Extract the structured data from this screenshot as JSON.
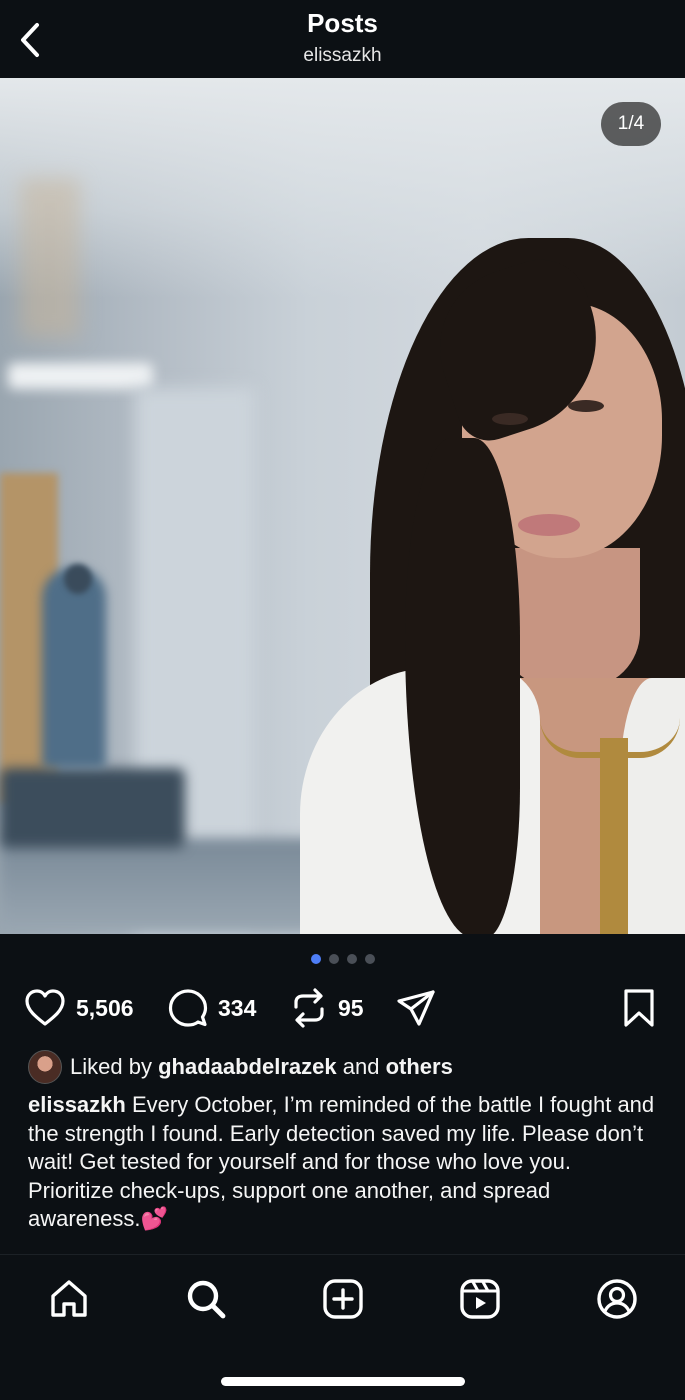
{
  "header": {
    "title": "Posts",
    "username": "elissazkh",
    "back_icon": "chevron-left-icon"
  },
  "post": {
    "media_counter": "1/4",
    "carousel": {
      "total": 4,
      "active_index": 0
    },
    "likes_count": "5,506",
    "comments_count": "334",
    "reposts_count": "95",
    "liked_by_prefix": "Liked by",
    "liked_by_user": "ghadaabdelrazek",
    "liked_by_and": "and",
    "liked_by_others": "others",
    "caption_user": "elissazkh",
    "caption_text": "Every October, I’m reminded of the battle I fought and the strength I found. Early detection saved my life. Please don’t wait! Get tested for yourself and for those who love you. Prioritize check-ups, support one another, and spread awareness.",
    "caption_emoji": "💕"
  },
  "actions": {
    "like_icon": "heart-icon",
    "comment_icon": "comment-icon",
    "repost_icon": "repost-icon",
    "share_icon": "send-icon",
    "save_icon": "bookmark-icon"
  },
  "nav": {
    "items": [
      "home-icon",
      "search-icon",
      "create-icon",
      "reels-icon",
      "profile-icon"
    ]
  },
  "colors": {
    "background": "#0c1014",
    "text": "#f5f5f5",
    "active_dot": "#4e7ef7",
    "inactive_dot": "#4a4f57"
  }
}
